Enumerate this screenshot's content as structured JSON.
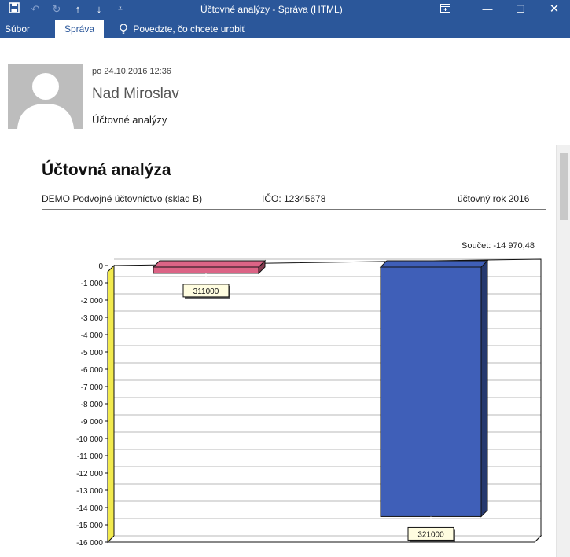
{
  "window": {
    "title": "Účtovné analýzy - Správa (HTML)",
    "icons": [
      "save-icon",
      "undo-icon",
      "redo-icon",
      "up-arrow-icon",
      "down-arrow-icon",
      "customize-icon",
      "ribbon-display-icon",
      "minimize-icon",
      "maximize-icon",
      "close-icon"
    ]
  },
  "ribbon": {
    "file_label": "Súbor",
    "message_label": "Správa",
    "tell_me_label": "Povedzte, čo chcete urobiť",
    "tell_me_icon": "lightbulb-icon"
  },
  "message": {
    "date": "po 24.10.2016 12:36",
    "sender": "Nad Miroslav",
    "subject": "Účtovné analýzy"
  },
  "document": {
    "title": "Účtovná analýza",
    "company": "DEMO Podvojné účtovníctvo (sklad B)",
    "ico": "IČO: 12345678",
    "year": "účtovný rok 2016",
    "sum_label": "Součet: -14 970,48"
  },
  "chart_data": {
    "type": "bar",
    "categories": [
      "311000",
      "321000"
    ],
    "values": [
      -450,
      -14520
    ],
    "colors": [
      "#dc6486",
      "#3f5fb8"
    ],
    "ylim": [
      -16000,
      0
    ],
    "yticks": [
      0,
      -1000,
      -2000,
      -3000,
      -4000,
      -5000,
      -6000,
      -7000,
      -8000,
      -9000,
      -10000,
      -11000,
      -12000,
      -13000,
      -14000,
      -15000,
      -16000
    ],
    "ytick_labels": [
      "0",
      "-1 000",
      "-2 000",
      "-3 000",
      "-4 000",
      "-5 000",
      "-6 000",
      "-7 000",
      "-8 000",
      "-9 000",
      "-10 000",
      "-11 000",
      "-12 000",
      "-13 000",
      "-14 000",
      "-15 000",
      "-16 000"
    ],
    "grid": true
  }
}
